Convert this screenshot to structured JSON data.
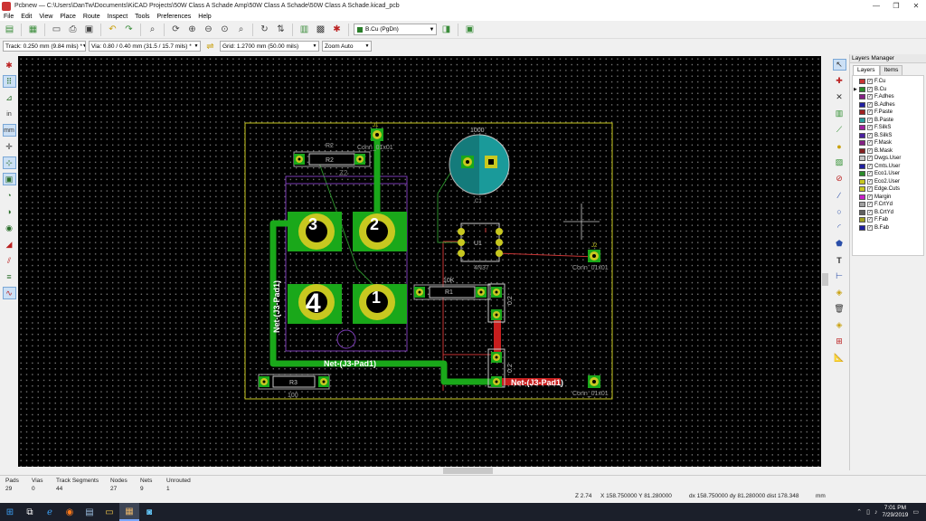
{
  "window": {
    "title": "Pcbnew — C:\\Users\\DanTw\\Documents\\KiCAD Projects\\50W Class A Schade Amp\\50W Class A Schade\\50W Class A Schade.kicad_pcb",
    "minimize": "—",
    "maximize": "❐",
    "close": "✕"
  },
  "menu": [
    "File",
    "Edit",
    "View",
    "Place",
    "Route",
    "Inspect",
    "Tools",
    "Preferences",
    "Help"
  ],
  "toolbar": {
    "active_layer": "B.Cu (PgDn)",
    "active_layer_color": "#2a7e2a"
  },
  "toolbar2": {
    "track": "Track: 0.250 mm (9.84 mils) *",
    "via": "Via: 0.80 / 0.40 mm (31.5 / 15.7 mils) *",
    "grid": "Grid: 1.2700 mm (50.00 mils)",
    "zoom": "Zoom Auto"
  },
  "layers_manager": {
    "title": "Layers Manager",
    "tabs": [
      "Layers",
      "Items"
    ],
    "active_layer_index": 1,
    "layers": [
      {
        "name": "F.Cu",
        "color": "#c83434",
        "checked": true
      },
      {
        "name": "B.Cu",
        "color": "#2a8c2a",
        "checked": true
      },
      {
        "name": "F.Adhes",
        "color": "#842084",
        "checked": true
      },
      {
        "name": "B.Adhes",
        "color": "#2020a0",
        "checked": true
      },
      {
        "name": "F.Paste",
        "color": "#a02020",
        "checked": true
      },
      {
        "name": "B.Paste",
        "color": "#2a9e9e",
        "checked": true
      },
      {
        "name": "F.SilkS",
        "color": "#a020a0",
        "checked": true
      },
      {
        "name": "B.SilkS",
        "color": "#4a20a0",
        "checked": true
      },
      {
        "name": "F.Mask",
        "color": "#842084",
        "checked": true
      },
      {
        "name": "B.Mask",
        "color": "#842020",
        "checked": true
      },
      {
        "name": "Dwgs.User",
        "color": "#c8c8c8",
        "checked": true
      },
      {
        "name": "Cmts.User",
        "color": "#2020a0",
        "checked": true
      },
      {
        "name": "Eco1.User",
        "color": "#2a8c2a",
        "checked": true
      },
      {
        "name": "Eco2.User",
        "color": "#c8c820",
        "checked": true
      },
      {
        "name": "Edge.Cuts",
        "color": "#c8c820",
        "checked": true
      },
      {
        "name": "Margin",
        "color": "#c820c8",
        "checked": true
      },
      {
        "name": "F.CrtYd",
        "color": "#a0a0a0",
        "checked": true
      },
      {
        "name": "B.CrtYd",
        "color": "#606060",
        "checked": true
      },
      {
        "name": "F.Fab",
        "color": "#a0a020",
        "checked": true
      },
      {
        "name": "B.Fab",
        "color": "#2020a0",
        "checked": true
      }
    ]
  },
  "board": {
    "j1_ref": "J1",
    "j1_value": "Conn_01x01",
    "j2_ref": "J2",
    "j2_value": "Conn_01x01",
    "j3_value": "Conn_01x01",
    "r2_ref": "R2",
    "r2_value": "R2",
    "r1_ref": "R1",
    "r1_value": "10K",
    "r3_ref": "R3",
    "r3_value": "100",
    "c1_ref": "C1",
    "c1_value": "1000",
    "u1_ref": "U1",
    "u1_value": "4N37",
    "q_ref": "Z2",
    "q_pad1": "1",
    "q_pad2": "2",
    "q_pad3": "3",
    "q_pad4": "4",
    "net_vertical": "Net-(J3-Pad1)",
    "net_bottom": "Net-(J3-Pad1)",
    "net_red": "Net-(J3-Pad1)",
    "small_val_1": "0.2",
    "small_val_2": "0.2"
  },
  "status": {
    "pads_label": "Pads",
    "pads": "29",
    "vias_label": "Vias",
    "vias": "0",
    "tracks_label": "Track Segments",
    "tracks": "44",
    "nodes_label": "Nodes",
    "nodes": "27",
    "nets_label": "Nets",
    "nets": "9",
    "unrouted_label": "Unrouted",
    "unrouted": "1"
  },
  "coords": {
    "zoom": "Z 2.74",
    "xy": "X 158.750000  Y 81.280000",
    "dxy": "dx 158.750000  dy 81.280000  dist 178.348",
    "units": "mm"
  },
  "taskbar": {
    "time": "7:01 PM",
    "date": "7/29/2019"
  }
}
